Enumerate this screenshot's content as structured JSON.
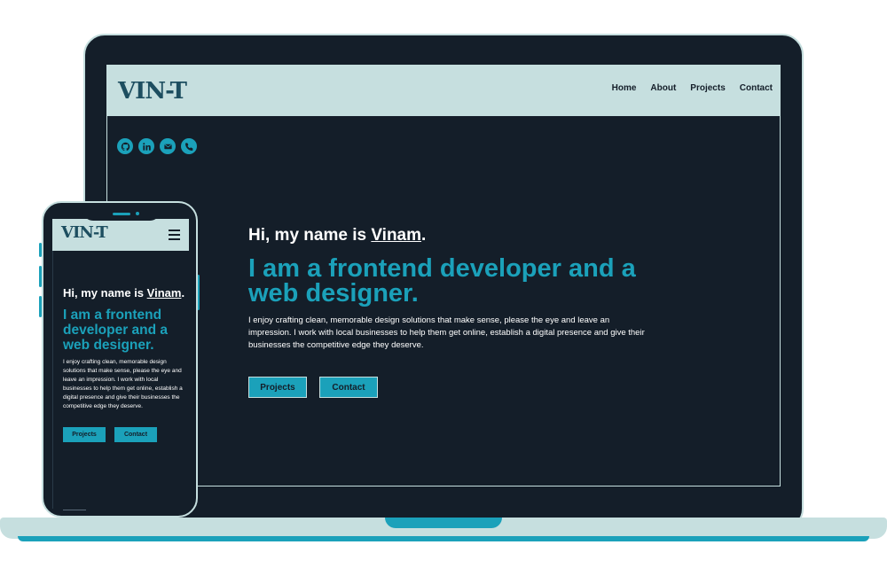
{
  "colors": {
    "background": "#141e29",
    "accent": "#1ba1ba",
    "nav_background": "#c6dfdf",
    "logo": "#1d4e60",
    "text": "#ffffff"
  },
  "desktop": {
    "logo": "VIN-T",
    "nav": [
      "Home",
      "About",
      "Projects",
      "Contact"
    ],
    "socials": [
      "github-icon",
      "linkedin-icon",
      "mail-icon",
      "phone-icon"
    ],
    "hero": {
      "greeting_prefix": "Hi, my name is ",
      "name": "Vinam",
      "greeting_suffix": ".",
      "role": "I am a frontend developer and a web designer.",
      "description": "I enjoy crafting clean, memorable design solutions that make sense, please the eye and leave an impression. I work with local businesses to help them get online, establish a digital presence and give their businesses the competitive edge they deserve.",
      "buttons": [
        "Projects",
        "Contact"
      ]
    }
  },
  "mobile": {
    "logo": "VIN-T",
    "menu_icon": "hamburger-icon",
    "hero": {
      "greeting_prefix": "Hi, my name is ",
      "name": "Vinam",
      "greeting_suffix": ".",
      "role": "I am a frontend developer and a web designer.",
      "description": "I enjoy crafting clean, memorable design solutions that make sense, please the eye and leave an impression. I work with local businesses to help them get online, establish a digital presence and give their businesses the competitive edge they deserve.",
      "buttons": [
        "Projects",
        "Contact"
      ]
    }
  }
}
